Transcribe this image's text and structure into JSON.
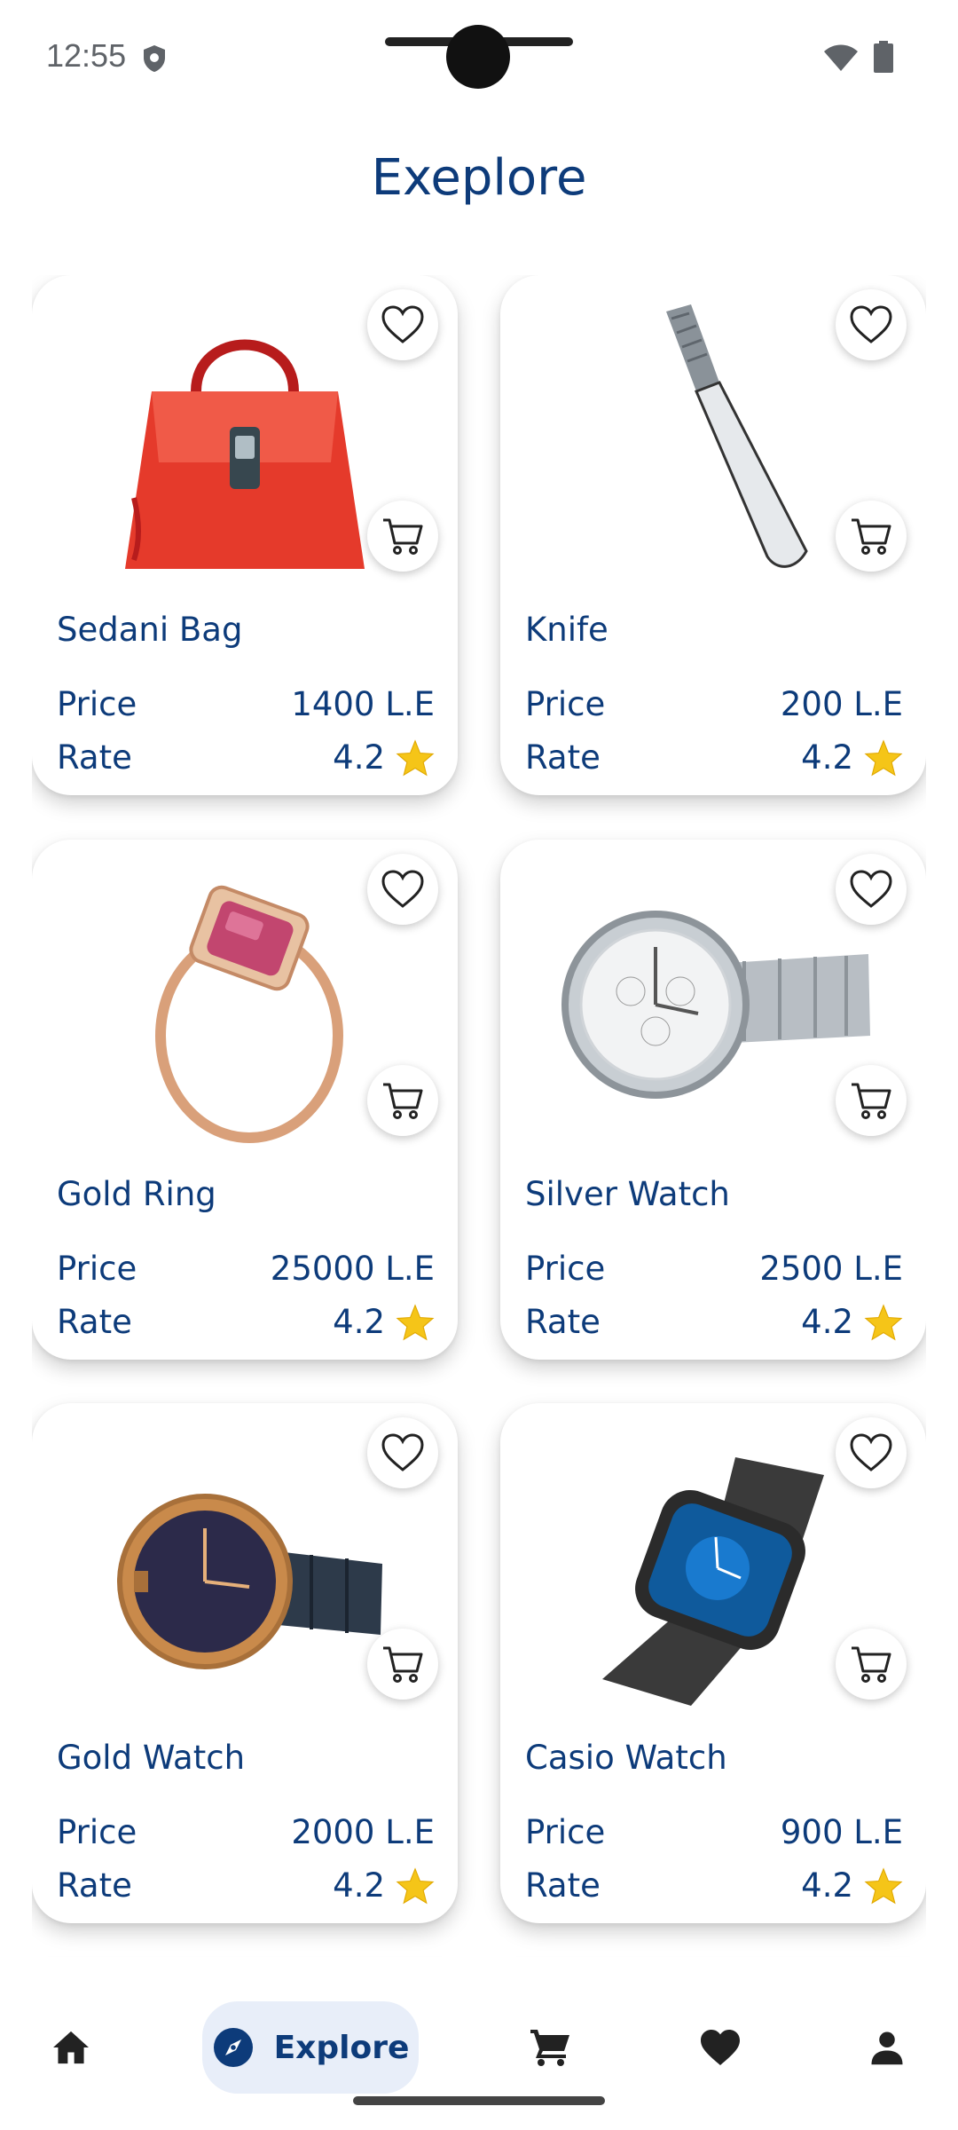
{
  "status_bar": {
    "time": "12:55"
  },
  "page_title": "Exeplore",
  "products": [
    {
      "name": "Sedani Bag",
      "price_label": "Price",
      "price": "1400 L.E",
      "rate_label": "Rate",
      "rate": "4.2",
      "image_icon": "handbag-icon"
    },
    {
      "name": "Knife",
      "price_label": "Price",
      "price": "200 L.E",
      "rate_label": "Rate",
      "rate": "4.2",
      "image_icon": "knife-icon"
    },
    {
      "name": "Gold Ring",
      "price_label": "Price",
      "price": "25000 L.E",
      "rate_label": "Rate",
      "rate": "4.2",
      "image_icon": "ring-icon"
    },
    {
      "name": "Silver Watch",
      "price_label": "Price",
      "price": "2500 L.E",
      "rate_label": "Rate",
      "rate": "4.2",
      "image_icon": "watch-icon"
    },
    {
      "name": "Gold Watch",
      "price_label": "Price",
      "price": "2000 L.E",
      "rate_label": "Rate",
      "rate": "4.2",
      "image_icon": "watch-icon"
    },
    {
      "name": "Casio Watch",
      "price_label": "Price",
      "price": "900 L.E",
      "rate_label": "Rate",
      "rate": "4.2",
      "image_icon": "smartwatch-icon"
    }
  ],
  "bottom_nav": {
    "items": [
      {
        "icon": "home-icon"
      },
      {
        "icon": "compass-icon",
        "label": "Explore",
        "active": true
      },
      {
        "icon": "cart-icon"
      },
      {
        "icon": "heart-icon"
      },
      {
        "icon": "person-icon"
      }
    ]
  },
  "colors": {
    "primary": "#0d3b7a",
    "active_pill": "#e8eef9",
    "star": "#f5c518",
    "bag": "#e53a2b"
  }
}
